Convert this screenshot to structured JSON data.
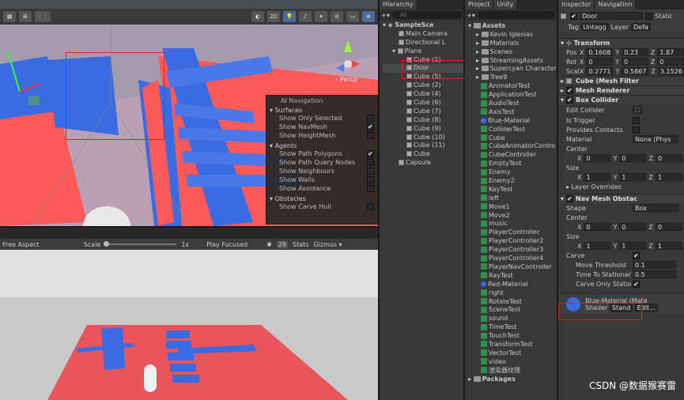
{
  "scene_toolbar": {
    "persp_label": "‹ Persp",
    "mode_2d": "2D"
  },
  "ai_nav": {
    "title": "AI Navigation",
    "surfaces": "Surfaces",
    "surface_rows": [
      {
        "label": "Show Only Selected",
        "checked": ""
      },
      {
        "label": "Show NavMesh",
        "checked": "✔"
      },
      {
        "label": "Show HeightMesh",
        "checked": ""
      }
    ],
    "agents": "Agents",
    "agent_rows": [
      {
        "label": "Show Path Polygons",
        "checked": "✔"
      },
      {
        "label": "Show Path Query Nodes",
        "checked": ""
      },
      {
        "label": "Show Neighbours",
        "checked": ""
      },
      {
        "label": "Show Walls",
        "checked": ""
      },
      {
        "label": "Show Avoidance",
        "checked": ""
      }
    ],
    "obstacles": "Obstacles",
    "obstacle_rows": [
      {
        "label": "Show Carve Hull",
        "checked": ""
      }
    ]
  },
  "game_toolbar": {
    "aspect": "Free Aspect",
    "scale_label": "Scale",
    "scale_value": "1x",
    "play_mode": "Play Focused",
    "stats": "Stats",
    "gizmos": "Gizmos ▾",
    "count": "29"
  },
  "hierarchy": {
    "tab": "Hierarchy",
    "search_placeholder": "All",
    "scene": "SampleSce",
    "items": [
      "Main Camera",
      "Directional L",
      "Plane",
      "Cube (1)",
      "Door",
      "Cube (5)",
      "Cube (2)",
      "Cube (4)",
      "Cube (6)",
      "Cube (7)",
      "Cube (8)",
      "Cube (9)",
      "Cube (10)",
      "Cube (11)",
      "Cube",
      "Capsule"
    ]
  },
  "project": {
    "tab": "Project",
    "tab2": "Unity",
    "root": "Assets",
    "folders": [
      "Kevin Iglesias",
      "Materials",
      "Scenes",
      "StreamingAssets",
      "Supercyan Character",
      "Tree9"
    ],
    "files": [
      "AnimatorTest",
      "ApplicationTest",
      "AudioTest",
      "AxisTest",
      "Blue-Material",
      "ColliderTest",
      "Cube",
      "CubeAnimatorContro",
      "CubeController",
      "EmptyTest",
      "Enemy",
      "Enemy2",
      "KeyTest",
      "left",
      "Move1",
      "Move2",
      "music",
      "PlayerController",
      "PlayerController2",
      "PlayerController3",
      "PlayerController4",
      "PlayerNavController",
      "RayTest",
      "Red-Material",
      "right",
      "RotateTest",
      "SceneTest",
      "sound",
      "TimeTest",
      "TouchTest",
      "TransformTest",
      "VectorTest",
      "video",
      "渲染器纹理"
    ],
    "packages": "Packages"
  },
  "inspector": {
    "tab": "Inspector",
    "tab2": "Navigation",
    "object_name": "Door",
    "static_label": "Static",
    "tag_label": "Tag",
    "tag_value": "Untagg",
    "layer_label": "Layer",
    "layer_value": "Defa",
    "transform": {
      "title": "Transform",
      "pos_label": "Pos",
      "rot_label": "Rot",
      "scale_label": "Scal",
      "pos": [
        "0.1608",
        "0.23",
        "1.87"
      ],
      "rot": [
        "0",
        "0",
        "0"
      ],
      "scale": [
        "0.2771",
        "0.5867",
        "3.1526"
      ],
      "x": "X",
      "y": "Y",
      "z": "Z"
    },
    "mesh_filter": "Cube (Mesh Filter",
    "mesh_renderer": "Mesh Renderer",
    "box_collider": "Box Collider",
    "edit_collider": "Edit Collider",
    "is_trigger": "Is Trigger",
    "provides_contacts": "Provides Contacts",
    "material": "Material",
    "material_value": "None (Phys",
    "center": "Center",
    "center_vals": [
      "0",
      "0",
      "0"
    ],
    "size": "Size",
    "size_vals": [
      "1",
      "1",
      "1"
    ],
    "layer_overrides": "Layer Overrides",
    "nav_obstacle": "Nav Mesh Obstac",
    "shape": "Shape",
    "shape_value": "Box",
    "nav_center_vals": [
      "0",
      "0",
      "0"
    ],
    "nav_size_vals": [
      "1",
      "1",
      "1"
    ],
    "carve": "Carve",
    "carve_check": "✔",
    "move_threshold": "Move Threshold",
    "move_threshold_value": "0.1",
    "time_to_stationary": "Time To Stationar",
    "time_value": "0.5",
    "carve_only_stationary": "Carve Only Statio",
    "carve_only_check": "✔",
    "material_name": "Blue-Material (Mate",
    "shader_label": "Shader",
    "shader_value": "Stand",
    "edit_label": "Edit..."
  },
  "watermark": "CSDN @数据猴赛雷"
}
